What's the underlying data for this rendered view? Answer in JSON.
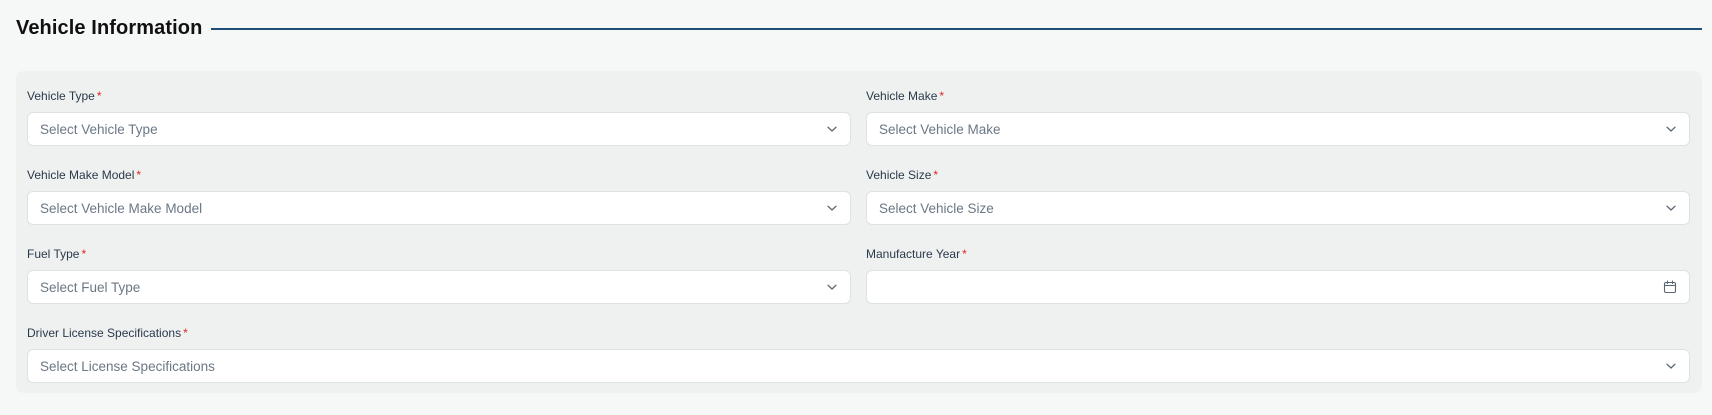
{
  "section": {
    "title": "Vehicle Information"
  },
  "required_marker": "*",
  "fields": {
    "vehicle_type": {
      "label": "Vehicle Type",
      "placeholder": "Select Vehicle Type",
      "icon": "chevron-down-icon"
    },
    "vehicle_make": {
      "label": "Vehicle Make",
      "placeholder": "Select Vehicle Make",
      "icon": "chevron-down-icon"
    },
    "vehicle_make_model": {
      "label": "Vehicle Make Model",
      "placeholder": "Select Vehicle Make Model",
      "icon": "chevron-down-icon"
    },
    "vehicle_size": {
      "label": "Vehicle Size",
      "placeholder": "Select Vehicle Size",
      "icon": "chevron-down-icon"
    },
    "fuel_type": {
      "label": "Fuel Type",
      "placeholder": "Select Fuel Type",
      "icon": "chevron-down-icon"
    },
    "manufacture_year": {
      "label": "Manufacture Year",
      "placeholder": "",
      "icon": "calendar-icon"
    },
    "driver_license_specifications": {
      "label": "Driver License Specifications",
      "placeholder": "Select License Specifications",
      "icon": "chevron-down-icon"
    }
  },
  "colors": {
    "accent_line": "#1f4e79",
    "required": "#e02424",
    "panel_bg": "#eff1f1",
    "page_bg": "#f6f7f7"
  }
}
